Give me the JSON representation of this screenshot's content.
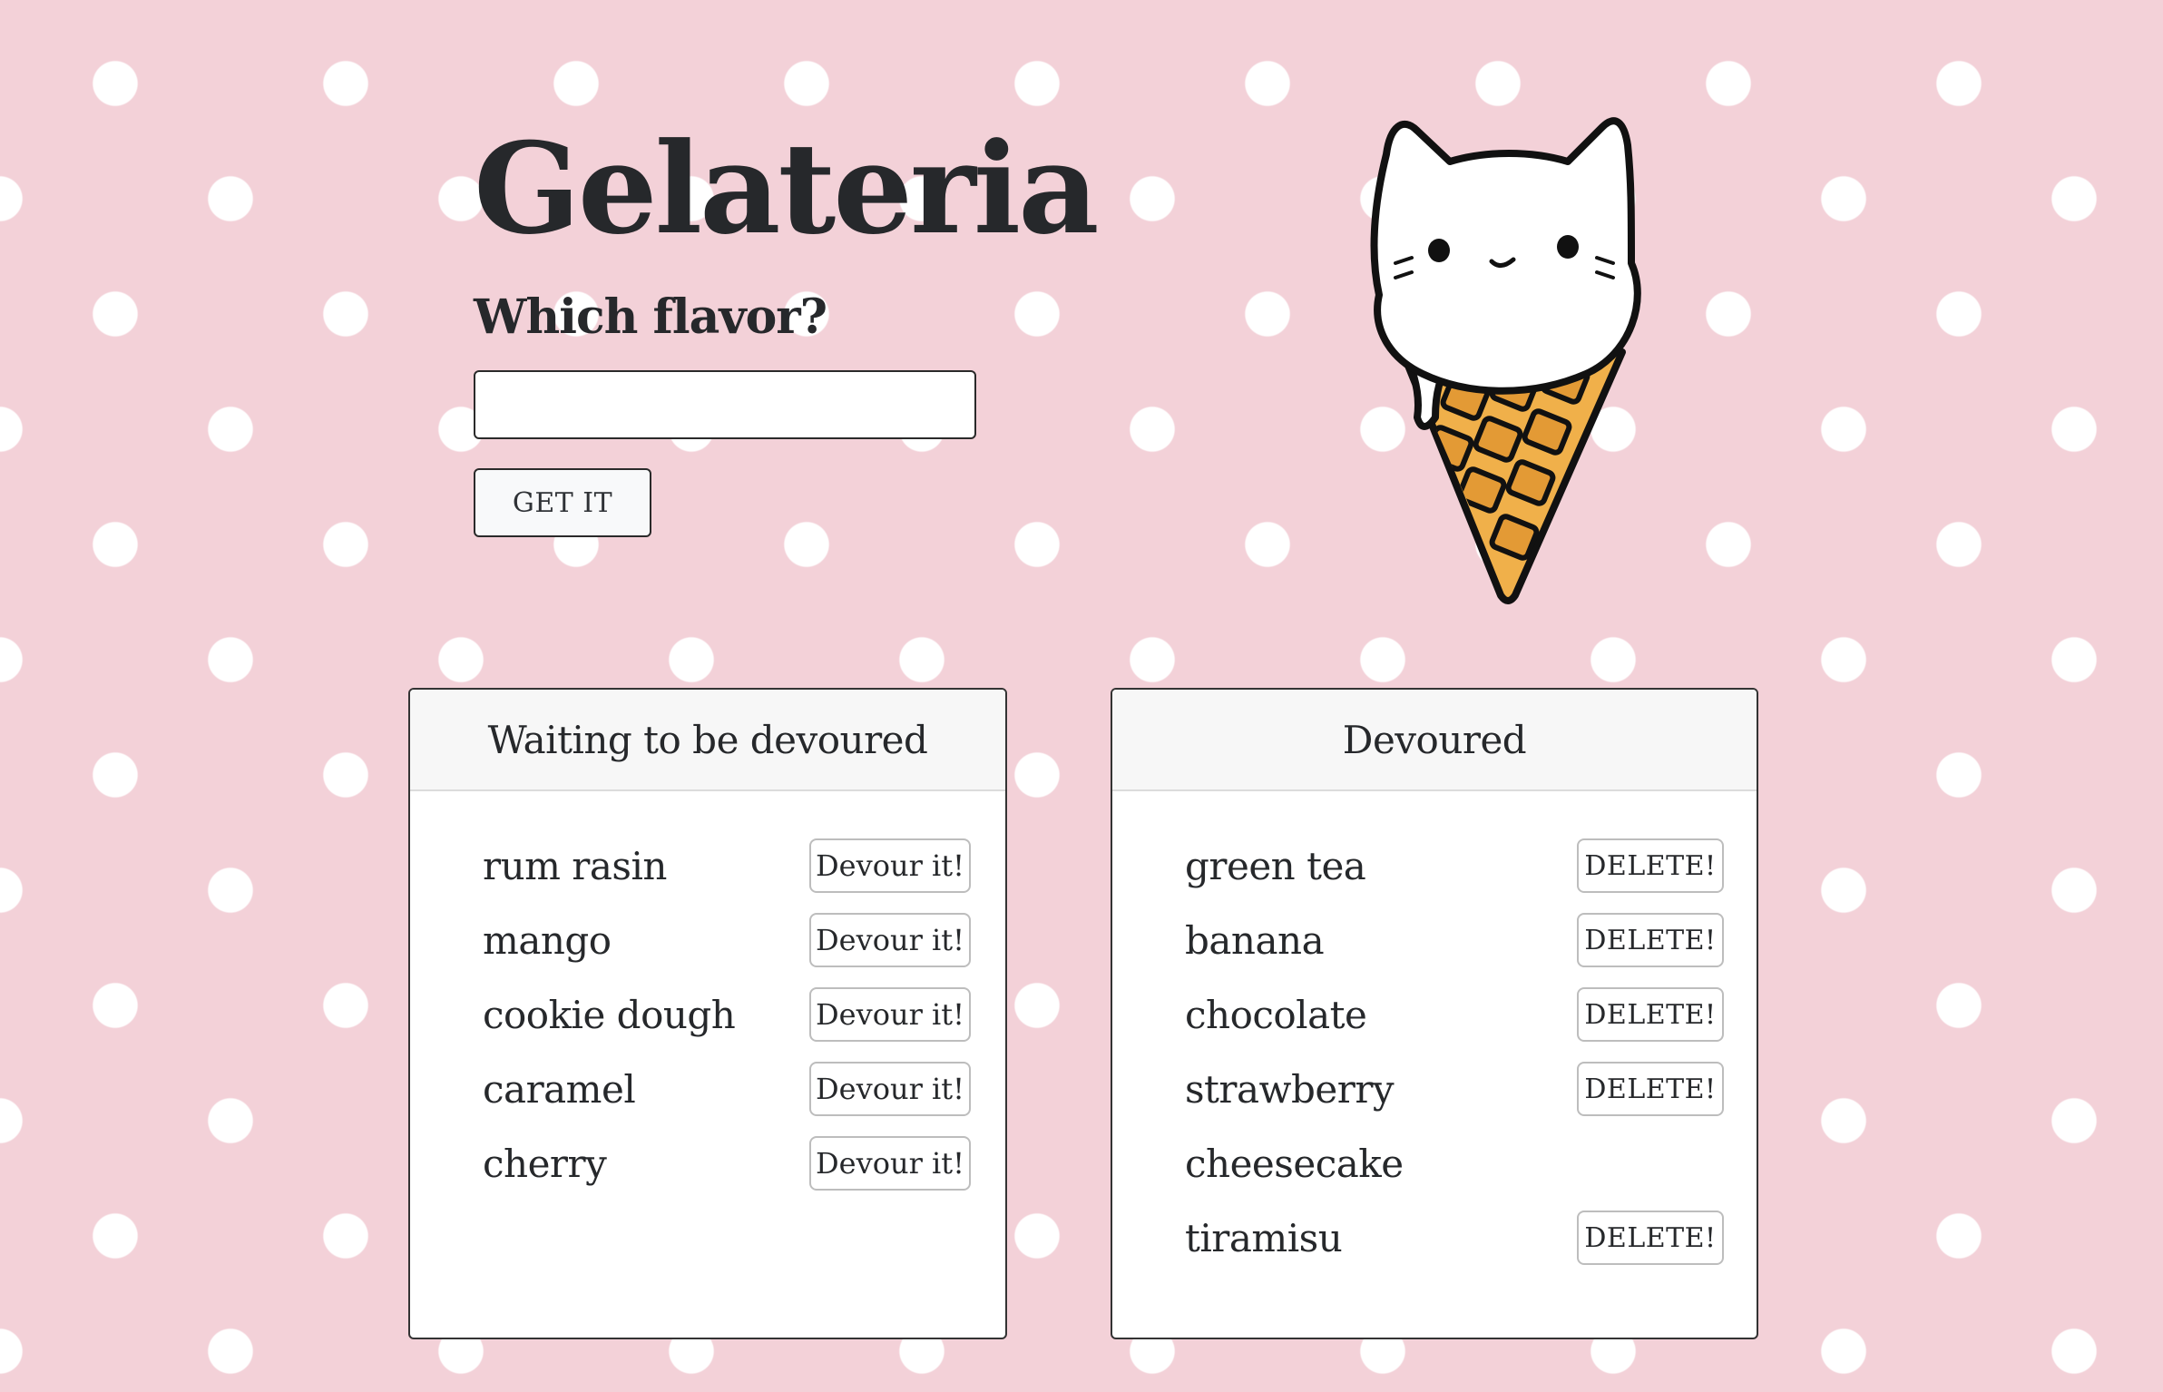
{
  "header": {
    "title": "Gelateria",
    "subtitle": "Which flavor?"
  },
  "form": {
    "input_value": "",
    "input_placeholder": "",
    "submit_label": "GET IT"
  },
  "waiting": {
    "heading": "Waiting to be devoured",
    "items": [
      {
        "name": "rum rasin",
        "action": "Devour it!"
      },
      {
        "name": "mango",
        "action": "Devour it!"
      },
      {
        "name": "cookie dough",
        "action": "Devour it!"
      },
      {
        "name": "caramel",
        "action": "Devour it!"
      },
      {
        "name": "cherry",
        "action": "Devour it!"
      }
    ]
  },
  "devoured": {
    "heading": "Devoured",
    "items": [
      {
        "name": "green tea",
        "action": "DELETE!"
      },
      {
        "name": "banana",
        "action": "DELETE!"
      },
      {
        "name": "chocolate",
        "action": "DELETE!"
      },
      {
        "name": "strawberry",
        "action": "DELETE!"
      },
      {
        "name": "cheesecake",
        "action": ""
      },
      {
        "name": "tiramisu",
        "action": "DELETE!"
      }
    ]
  },
  "colors": {
    "background": "#f3d1d8",
    "dots": "#ffffff",
    "cone": "#f0b04a",
    "text": "#26282b"
  },
  "icons": {
    "mascot": "cat-ice-cream-cone-icon"
  }
}
